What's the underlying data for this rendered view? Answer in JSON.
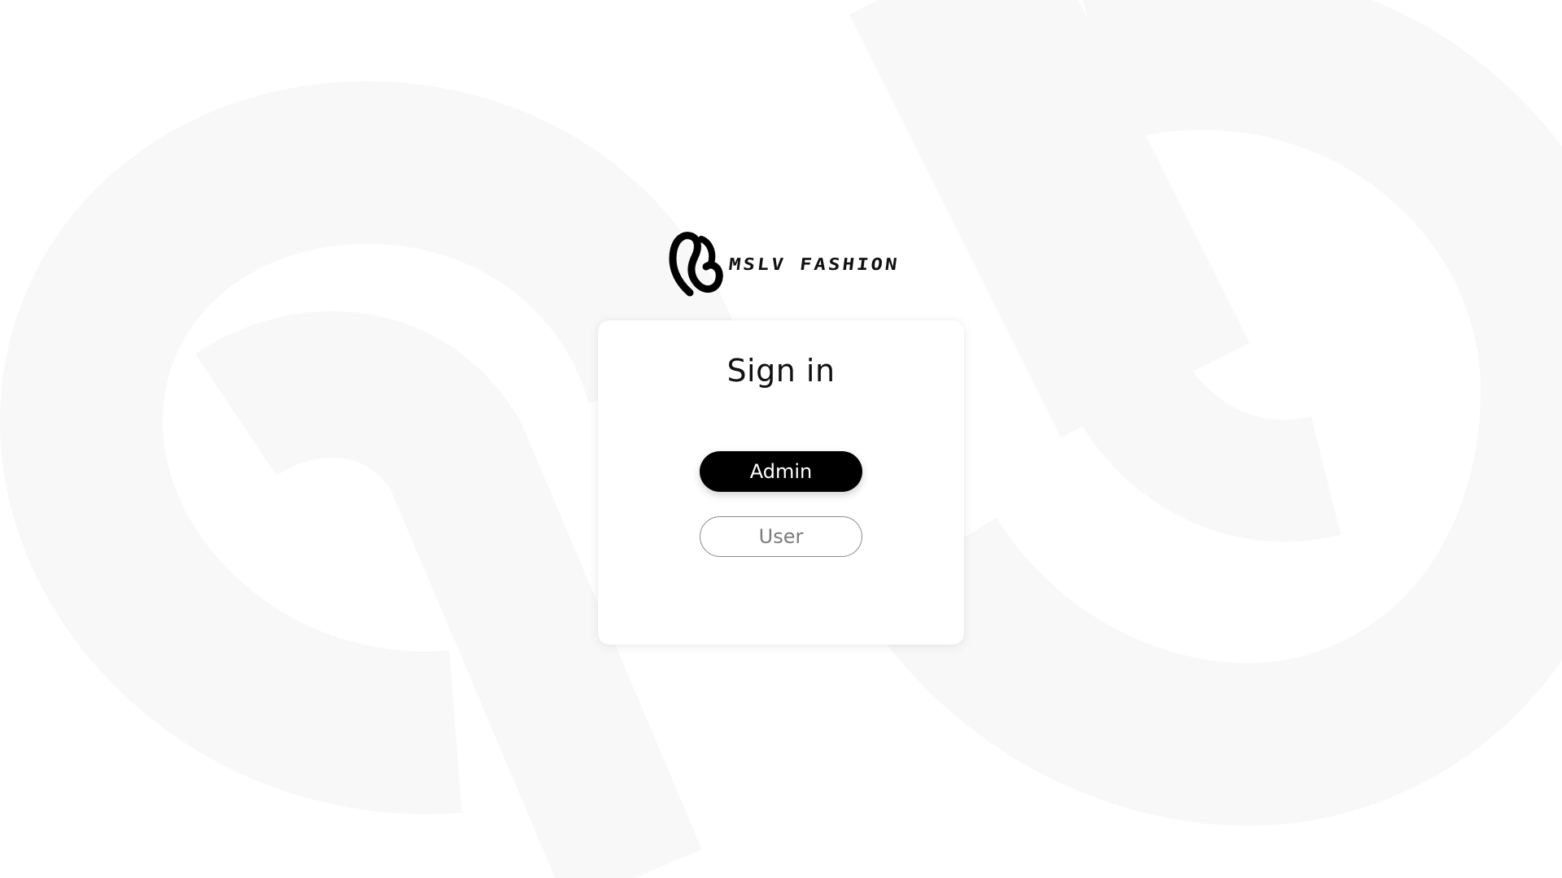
{
  "brand": {
    "name": "MSLV FASHION",
    "logo_icon": "mslv-monogram-logo"
  },
  "signin": {
    "title": "Sign in",
    "admin_label": "Admin",
    "user_label": "User"
  },
  "colors": {
    "background": "#ffffff",
    "watermark": "#f8f8f8",
    "primary_button": "#000000",
    "secondary_button_border": "#8a8a8a",
    "secondary_button_text": "#7a7a7a"
  }
}
